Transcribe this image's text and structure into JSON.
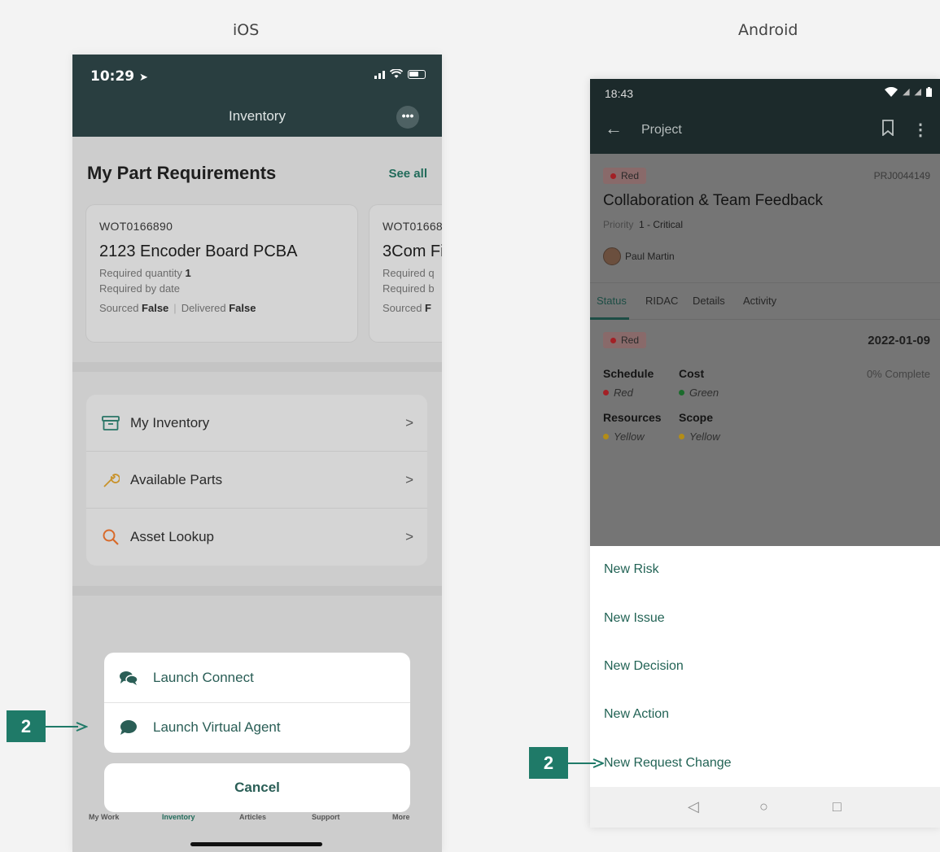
{
  "labels": {
    "ios": "iOS",
    "android": "Android"
  },
  "colors": {
    "ios_header": "#293e40",
    "android_header": "#1c2a2b",
    "accent": "#226355",
    "callout": "#1f7a68",
    "red": "#a32025",
    "green": "#2e7d32",
    "yellow": "#d4a017"
  },
  "ios": {
    "time": "10:29",
    "title": "Inventory",
    "more_icon": "ellipsis-icon",
    "section_title": "My Part Requirements",
    "see_all": "See all",
    "cards": [
      {
        "number": "WOT0166890",
        "name": "2123 Encoder Board PCBA",
        "qty_label": "Required quantity",
        "qty": "1",
        "date_label": "Required by date",
        "sourced_label": "Sourced",
        "sourced": "False",
        "delivered_label": "Delivered",
        "delivered": "False"
      },
      {
        "number": "WOT01668",
        "name": "3Com Fi",
        "qty_label": "Required q",
        "date_label": "Required b",
        "sourced_label": "Sourced",
        "sourced": "F"
      }
    ],
    "menu": [
      {
        "label": "My Inventory",
        "icon": "archive-box-icon"
      },
      {
        "label": "Available Parts",
        "icon": "wrench-icon"
      },
      {
        "label": "Asset Lookup",
        "icon": "search-icon"
      }
    ],
    "action_sheet": [
      {
        "label": "Launch Connect",
        "icon": "chat-bubbles-icon"
      },
      {
        "label": "Launch Virtual Agent",
        "icon": "chat-bubble-icon"
      }
    ],
    "cancel": "Cancel",
    "tabs": [
      "My Work",
      "Inventory",
      "Articles",
      "Support",
      "More"
    ]
  },
  "android": {
    "time": "18:43",
    "title": "Project",
    "state": "Red",
    "number": "PRJ0044149",
    "project_name": "Collaboration & Team Feedback",
    "priority_label": "Priority",
    "priority": "1 - Critical",
    "user": "Paul Martin",
    "tabs": [
      "Status",
      "RIDAC",
      "Details",
      "Activity"
    ],
    "status_pill": "Red",
    "date": "2022-01-09",
    "schedule_label": "Schedule",
    "schedule": "Red",
    "cost_label": "Cost",
    "cost": "Green",
    "resources_label": "Resources",
    "resources": "Yellow",
    "scope_label": "Scope",
    "scope": "Yellow",
    "complete": "0% Complete",
    "sheet_items": [
      "New Risk",
      "New Issue",
      "New Decision",
      "New Action",
      "New Request Change"
    ]
  },
  "callouts": {
    "ios": "2",
    "android": "2"
  }
}
